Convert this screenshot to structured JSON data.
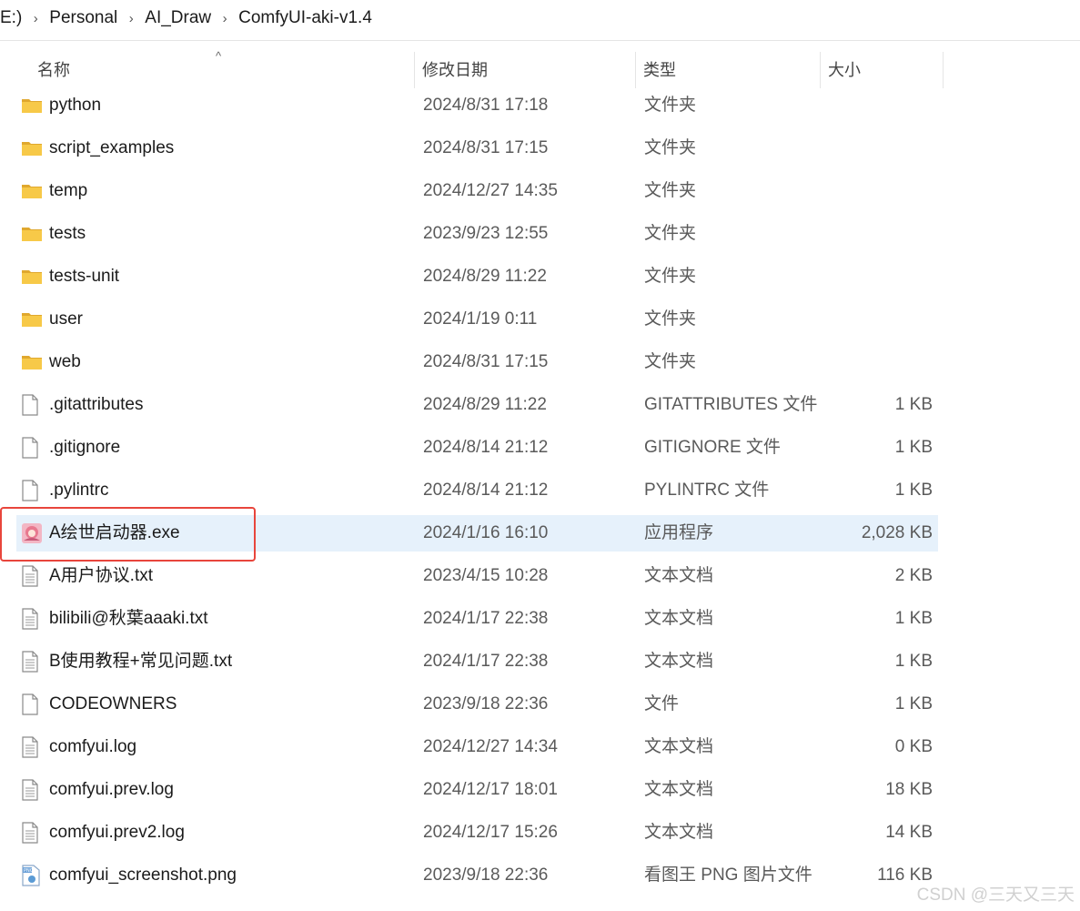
{
  "breadcrumb": {
    "drive": "E:)",
    "segments": [
      "Personal",
      "AI_Draw",
      "ComfyUI-aki-v1.4"
    ],
    "separator": "›"
  },
  "columns": {
    "name": "名称",
    "date": "修改日期",
    "type": "类型",
    "size": "大小",
    "sort_indicator": "^"
  },
  "files": [
    {
      "name": "python",
      "date": "2024/8/31 17:18",
      "type": "文件夹",
      "size": "",
      "icon": "folder-icon"
    },
    {
      "name": "script_examples",
      "date": "2024/8/31 17:15",
      "type": "文件夹",
      "size": "",
      "icon": "folder-icon"
    },
    {
      "name": "temp",
      "date": "2024/12/27 14:35",
      "type": "文件夹",
      "size": "",
      "icon": "folder-icon"
    },
    {
      "name": "tests",
      "date": "2023/9/23 12:55",
      "type": "文件夹",
      "size": "",
      "icon": "folder-icon"
    },
    {
      "name": "tests-unit",
      "date": "2024/8/29 11:22",
      "type": "文件夹",
      "size": "",
      "icon": "folder-icon"
    },
    {
      "name": "user",
      "date": "2024/1/19 0:11",
      "type": "文件夹",
      "size": "",
      "icon": "folder-icon"
    },
    {
      "name": "web",
      "date": "2024/8/31 17:15",
      "type": "文件夹",
      "size": "",
      "icon": "folder-icon"
    },
    {
      "name": ".gitattributes",
      "date": "2024/8/29 11:22",
      "type": "GITATTRIBUTES 文件",
      "size": "1 KB",
      "icon": "blank-file-icon"
    },
    {
      "name": ".gitignore",
      "date": "2024/8/14 21:12",
      "type": "GITIGNORE 文件",
      "size": "1 KB",
      "icon": "blank-file-icon"
    },
    {
      "name": ".pylintrc",
      "date": "2024/8/14 21:12",
      "type": "PYLINTRC 文件",
      "size": "1 KB",
      "icon": "blank-file-icon"
    },
    {
      "name": "A绘世启动器.exe",
      "date": "2024/1/16 16:10",
      "type": "应用程序",
      "size": "2,028 KB",
      "icon": "app-icon",
      "selected": true
    },
    {
      "name": "A用户协议.txt",
      "date": "2023/4/15 10:28",
      "type": "文本文档",
      "size": "2 KB",
      "icon": "text-file-icon"
    },
    {
      "name": "bilibili@秋葉aaaki.txt",
      "date": "2024/1/17 22:38",
      "type": "文本文档",
      "size": "1 KB",
      "icon": "text-file-icon"
    },
    {
      "name": "B使用教程+常见问题.txt",
      "date": "2024/1/17 22:38",
      "type": "文本文档",
      "size": "1 KB",
      "icon": "text-file-icon"
    },
    {
      "name": "CODEOWNERS",
      "date": "2023/9/18 22:36",
      "type": "文件",
      "size": "1 KB",
      "icon": "blank-file-icon"
    },
    {
      "name": "comfyui.log",
      "date": "2024/12/27 14:34",
      "type": "文本文档",
      "size": "0 KB",
      "icon": "text-file-icon"
    },
    {
      "name": "comfyui.prev.log",
      "date": "2024/12/17 18:01",
      "type": "文本文档",
      "size": "18 KB",
      "icon": "text-file-icon"
    },
    {
      "name": "comfyui.prev2.log",
      "date": "2024/12/17 15:26",
      "type": "文本文档",
      "size": "14 KB",
      "icon": "text-file-icon"
    },
    {
      "name": "comfyui_screenshot.png",
      "date": "2023/9/18 22:36",
      "type": "看图王 PNG 图片文件",
      "size": "116 KB",
      "icon": "png-file-icon"
    }
  ],
  "watermark": "CSDN @三天又三天",
  "colors": {
    "selection": "#e6f1fb",
    "highlight_border": "#e8453c",
    "folder": "#f4c23d"
  }
}
